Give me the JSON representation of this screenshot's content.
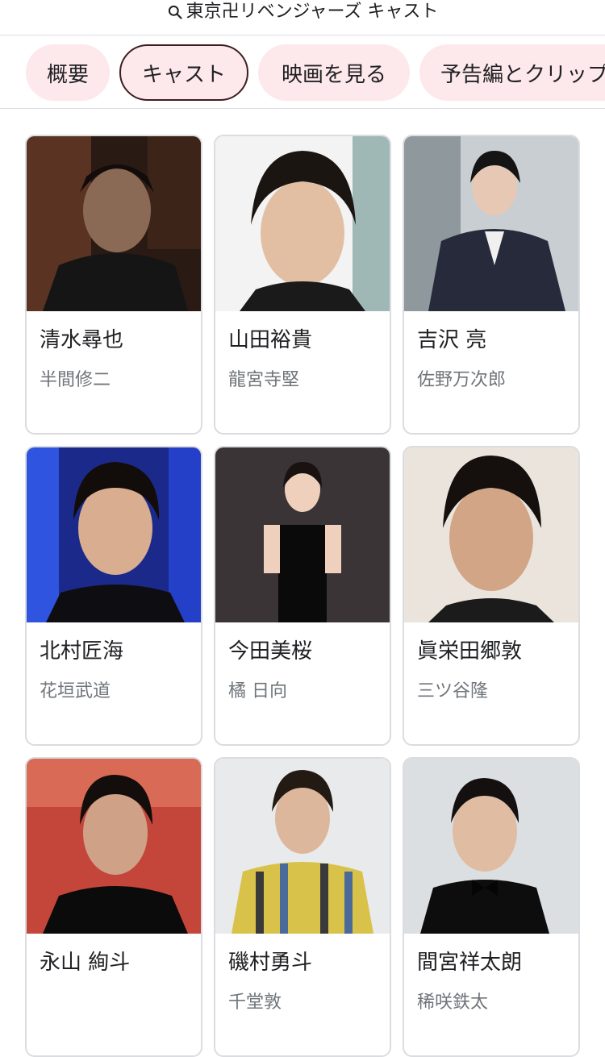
{
  "search": {
    "query": "東京卍リベンジャーズ キャスト"
  },
  "tabs": [
    {
      "label": "概要",
      "active": false
    },
    {
      "label": "キャスト",
      "active": true
    },
    {
      "label": "映画を見る",
      "active": false
    },
    {
      "label": "予告編とクリップ",
      "active": false
    }
  ],
  "cast": [
    {
      "name": "清水尋也",
      "role": "半間修二"
    },
    {
      "name": "山田裕貴",
      "role": "龍宮寺堅"
    },
    {
      "name": "吉沢 亮",
      "role": "佐野万次郎"
    },
    {
      "name": "北村匠海",
      "role": "花垣武道"
    },
    {
      "name": "今田美桜",
      "role": "橘 日向"
    },
    {
      "name": "眞栄田郷敦",
      "role": "三ツ谷隆"
    },
    {
      "name": "永山 絢斗",
      "role": ""
    },
    {
      "name": "磯村勇斗",
      "role": "千堂敦"
    },
    {
      "name": "間宮祥太朗",
      "role": "稀咲鉄太"
    }
  ],
  "colors": {
    "chip_bg": "#fde8ec",
    "chip_active_border": "#3c1e22",
    "secondary_text": "#70757a",
    "divider": "#dadce0"
  }
}
